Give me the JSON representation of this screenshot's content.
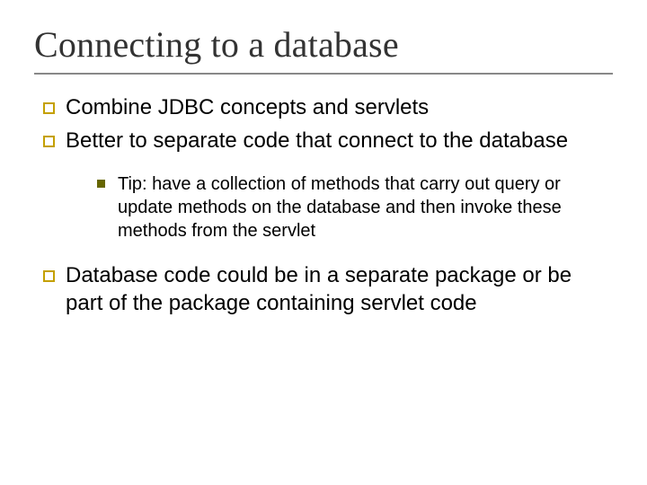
{
  "title": "Connecting to a database",
  "bullets": {
    "b1": "Combine JDBC concepts and servlets",
    "b2": "Better to separate code that connect to the database",
    "b2_sub1": "Tip:  have a collection of methods that carry out query or update methods on the database and then invoke these methods from the servlet",
    "b3": "Database code could be in a separate package or be part of the package containing servlet code"
  }
}
